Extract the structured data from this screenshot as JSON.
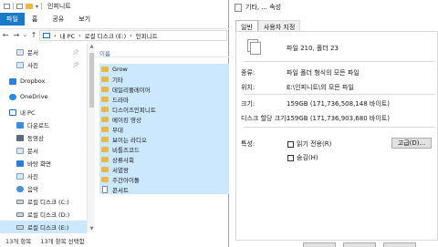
{
  "explorer": {
    "title": "인피니트",
    "ribbon_tabs": [
      "파일",
      "홈",
      "공유",
      "보기"
    ],
    "address": [
      "내 PC",
      "로컬 디스크 (E:)",
      "인피니트"
    ],
    "nav": [
      {
        "label": "문서",
        "icon": "documents-icon",
        "pinned": true
      },
      {
        "label": "사진",
        "icon": "pictures-icon",
        "pinned": true
      },
      {
        "label": "Dropbox",
        "icon": "dropbox-icon",
        "pinned": false
      },
      {
        "label": "OneDrive",
        "icon": "onedrive-icon",
        "pinned": false
      },
      {
        "label": "내 PC",
        "icon": "pc-icon",
        "pinned": false
      },
      {
        "label": "다운로드",
        "icon": "download-icon",
        "pinned": false
      },
      {
        "label": "동영상",
        "icon": "videos-icon",
        "pinned": false
      },
      {
        "label": "문서",
        "icon": "documents-icon",
        "pinned": false
      },
      {
        "label": "바탕 화면",
        "icon": "desktop-icon",
        "pinned": false
      },
      {
        "label": "사진",
        "icon": "pictures-icon",
        "pinned": false
      },
      {
        "label": "음악",
        "icon": "music-icon",
        "pinned": false
      },
      {
        "label": "로컬 디스크 (C:)",
        "icon": "drive-icon",
        "pinned": false
      },
      {
        "label": "로컬 디스크 (D:)",
        "icon": "drive-icon",
        "pinned": false
      },
      {
        "label": "로컬 디스크 (E:)",
        "icon": "drive-icon",
        "pinned": false
      }
    ],
    "column_header": "이름",
    "files": [
      {
        "name": "Grow",
        "type": "folder"
      },
      {
        "name": "기타",
        "type": "folder"
      },
      {
        "name": "데일리플레이어",
        "type": "folder"
      },
      {
        "name": "드라마",
        "type": "folder"
      },
      {
        "name": "디스이즈인피니트",
        "type": "folder"
      },
      {
        "name": "메이킹 영상",
        "type": "folder"
      },
      {
        "name": "무대",
        "type": "folder"
      },
      {
        "name": "보이는 라디오",
        "type": "folder"
      },
      {
        "name": "비틀즈코드",
        "type": "folder"
      },
      {
        "name": "상류사회",
        "type": "folder"
      },
      {
        "name": "서열왕",
        "type": "folder"
      },
      {
        "name": "주간아이돌",
        "type": "folder"
      },
      {
        "name": "콘서트",
        "type": "file"
      }
    ],
    "status": {
      "count": "13개 항목",
      "selected": "13개 항목 선택함"
    }
  },
  "properties": {
    "title": "기타, ... 속성",
    "tabs": [
      "일반",
      "사용자 지정"
    ],
    "summary": "파일 210, 폴더 23",
    "rows": [
      {
        "label": "종류:",
        "value": "파일 폴더 형식의 모든 파일"
      },
      {
        "label": "위치:",
        "value": "E:\\인피니트\\의 모든 파일"
      },
      {
        "label": "크기:",
        "value": "159GB (171,736,508,148 바이트)"
      },
      {
        "label": "디스크 할당 크기:",
        "value": "159GB (171,736,903,680 바이트)"
      }
    ],
    "attributes_label": "특성:",
    "readonly_label": "읽기 전용(R)",
    "hidden_label": "숨김(H)",
    "advanced_label": "고급(D)..."
  }
}
